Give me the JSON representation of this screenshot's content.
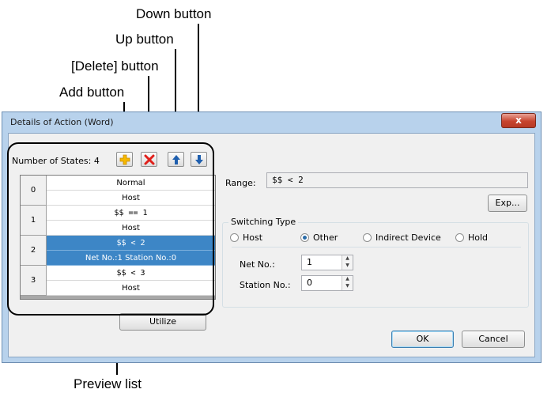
{
  "callouts": {
    "down": "Down button",
    "up": "Up button",
    "delete": "[Delete] button",
    "add": "Add button",
    "preview": "Preview list"
  },
  "window": {
    "title": "Details of Action (Word)",
    "close_glyph": "x"
  },
  "states": {
    "count_label": "Number of States: 4",
    "rows": [
      {
        "index": "0",
        "line1": "Normal",
        "line2": "Host",
        "selected": false
      },
      {
        "index": "1",
        "line1": "$$ == 1",
        "line2": "Host",
        "selected": false
      },
      {
        "index": "2",
        "line1": "$$ < 2",
        "line2": "Net No.:1 Station No.:0",
        "selected": true
      },
      {
        "index": "3",
        "line1": "$$ < 3",
        "line2": "Host",
        "selected": false
      }
    ],
    "utilize_label": "Utilize"
  },
  "range": {
    "label": "Range:",
    "value": "$$ < 2",
    "exp_label": "Exp..."
  },
  "switching": {
    "title": "Switching Type",
    "options": [
      "Host",
      "Other",
      "Indirect Device",
      "Hold"
    ],
    "selected": "Other"
  },
  "net": {
    "label": "Net No.:",
    "value": "1"
  },
  "station": {
    "label": "Station No.:",
    "value": "0"
  },
  "footer": {
    "ok_label": "OK",
    "cancel_label": "Cancel"
  },
  "icons": {
    "add": "add-icon",
    "delete": "delete-icon",
    "up": "arrow-up-icon",
    "down": "arrow-down-icon"
  },
  "colors": {
    "selection": "#3d86c6",
    "add_icon": "#f5b800",
    "delete_icon": "#e0201b",
    "arrow_icon": "#1f5fae",
    "close_button": "#c7442e"
  }
}
